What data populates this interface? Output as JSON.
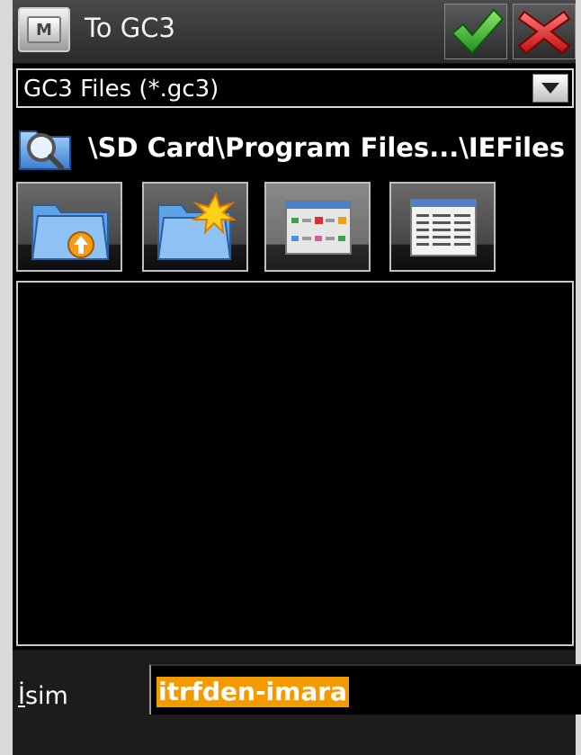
{
  "header": {
    "menu_icon_letter": "M",
    "title": "To GC3",
    "ok_icon": "green-checkmark-icon",
    "cancel_icon": "red-x-icon"
  },
  "filetype": {
    "selected": "GC3 Files (*.gc3)"
  },
  "path": {
    "icon": "folder-search-icon",
    "text": "\\SD Card\\Program Files...\\IEFiles"
  },
  "toolbar": {
    "buttons": [
      {
        "icon": "folder-up-icon"
      },
      {
        "icon": "new-folder-icon"
      },
      {
        "icon": "list-view-icon"
      },
      {
        "icon": "details-view-icon"
      }
    ]
  },
  "file_list": {
    "items": []
  },
  "name_field": {
    "label_first": "İ",
    "label_rest": "sim",
    "value": "itrfden-imara"
  },
  "colors": {
    "selection": "#f39a00",
    "ok": "#2fb82f",
    "cancel": "#e02020"
  }
}
